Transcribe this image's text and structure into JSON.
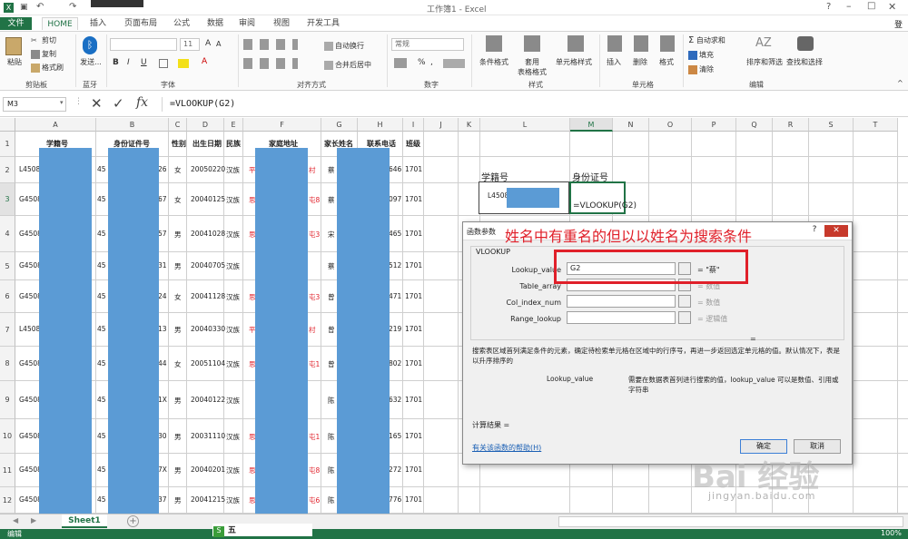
{
  "window": {
    "title": "工作簿1 - Excel",
    "user": "登"
  },
  "tabs": [
    "文件",
    "HOME",
    "插入",
    "页面布局",
    "公式",
    "数据",
    "审阅",
    "视图",
    "开发工具"
  ],
  "ribbon": {
    "clipboard": {
      "paste": "粘贴",
      "cut": "剪切",
      "copy": "复制",
      "format_painter": "格式刷",
      "group": "剪贴板"
    },
    "bluetooth": {
      "send": "发送...",
      "group": "蓝牙"
    },
    "font": {
      "size": "11",
      "bold": "B",
      "italic": "I",
      "underline": "U",
      "group": "字体"
    },
    "alignment": {
      "wrap": "自动换行",
      "merge": "合并后居中",
      "group": "对齐方式"
    },
    "number": {
      "format": "常规",
      "percent": "%",
      "comma": ",",
      "group": "数字"
    },
    "styles": {
      "cond": "条件格式",
      "table": "套用\n表格格式",
      "cell": "单元格样式",
      "group": "样式"
    },
    "cells": {
      "insert": "插入",
      "delete": "删除",
      "format": "格式",
      "group": "单元格"
    },
    "editing": {
      "autosum": "自动求和",
      "fill": "填充",
      "clear": "清除",
      "sort": "排序和筛选",
      "find": "查找和选择",
      "group": "编辑"
    }
  },
  "formula_bar": {
    "name_box": "M3",
    "fx": "fx",
    "formula": "=VLOOKUP(G2)"
  },
  "columns": [
    "A",
    "B",
    "C",
    "D",
    "E",
    "F",
    "G",
    "H",
    "I",
    "J",
    "K",
    "L",
    "M",
    "N",
    "O",
    "P",
    "Q",
    "R",
    "S",
    "T"
  ],
  "rows": [
    "1",
    "2",
    "3",
    "4",
    "5",
    "6",
    "7",
    "8",
    "9",
    "10",
    "11",
    "12"
  ],
  "headers": {
    "A": "学籍号",
    "B": "身份证件号",
    "C": "性别",
    "D": "出生日期",
    "E": "民族",
    "F": "家庭地址",
    "G": "家长姓名",
    "H": "联系电话",
    "I": "班级"
  },
  "table_rows": [
    {
      "a": "L4508",
      "b": "45",
      "b2": "26",
      "c": "女",
      "d": "20050220",
      "e": "汉族",
      "f": "平",
      "f2": "村",
      "g": "蔡",
      "h": "646",
      "i": "1701"
    },
    {
      "a": "G4508",
      "b": "45",
      "b2": "67",
      "c": "女",
      "d": "20040125",
      "e": "汉族",
      "f": "思",
      "f2": "屯8",
      "g": "蔡",
      "h": "097",
      "i": "1701"
    },
    {
      "a": "G4508",
      "b": "45",
      "b2": "57",
      "c": "男",
      "d": "20041028",
      "e": "汉族",
      "f": "思",
      "f2": "屯3",
      "g": "宋",
      "h": "465",
      "i": "1701"
    },
    {
      "a": "G4508",
      "b": "45",
      "b2": "31",
      "c": "男",
      "d": "20040705",
      "e": "汉族",
      "f": "",
      "f2": "",
      "g": "蔡",
      "h": "512",
      "i": "1701"
    },
    {
      "a": "G4508",
      "b": "45",
      "b2": "24",
      "c": "女",
      "d": "20041128",
      "e": "汉族",
      "f": "思",
      "f2": "屯3",
      "g": "曾",
      "h": "471",
      "i": "1701"
    },
    {
      "a": "L4508",
      "b": "45",
      "b2": "13",
      "c": "男",
      "d": "20040330",
      "e": "汉族",
      "f": "平",
      "f2": "村",
      "g": "曾",
      "h": "219",
      "i": "1701"
    },
    {
      "a": "G4508",
      "b": "45",
      "b2": "44",
      "c": "女",
      "d": "20051104",
      "e": "汉族",
      "f": "思",
      "f2": "屯1",
      "g": "曾",
      "h": "802",
      "i": "1701"
    },
    {
      "a": "G4508",
      "b": "45",
      "b2": "1X",
      "c": "男",
      "d": "20040122",
      "e": "汉族",
      "f": "",
      "f2": "",
      "g": "陈",
      "h": "632",
      "i": "1701"
    },
    {
      "a": "G4508",
      "b": "45",
      "b2": "30",
      "c": "男",
      "d": "20031110",
      "e": "汉族",
      "f": "思",
      "f2": "屯1",
      "g": "陈",
      "h": "165",
      "i": "1701"
    },
    {
      "a": "G4508",
      "b": "45",
      "b2": "7X",
      "c": "男",
      "d": "20040201",
      "e": "汉族",
      "f": "思",
      "f2": "屯8",
      "g": "陈",
      "h": "272",
      "i": "1701"
    },
    {
      "a": "G4508",
      "b": "45",
      "b2": "37",
      "c": "男",
      "d": "20041215",
      "e": "汉族",
      "f": "思",
      "f2": "屯6",
      "g": "陈",
      "h": "776",
      "i": "1701"
    }
  ],
  "lookup_box": {
    "h1": "学籍号",
    "h2": "身份证号",
    "l3": "L4508",
    "m3": "=VLOOKUP(G2)"
  },
  "dialog": {
    "title": "函数参数",
    "annotation": "姓名中有重名的但以以姓名为搜索条件",
    "func": "VLOOKUP",
    "args": [
      {
        "name": "Lookup_value",
        "value": "G2",
        "result": "= \"蔡\""
      },
      {
        "name": "Table_array",
        "value": "",
        "result": "= 数值"
      },
      {
        "name": "Col_index_num",
        "value": "",
        "result": "= 数值"
      },
      {
        "name": "Range_lookup",
        "value": "",
        "result": "= 逻辑值"
      }
    ],
    "eq": "=",
    "desc": "搜索表区域首列满足条件的元素，确定待检索单元格在区域中的行序号，再进一步返回选定单元格的值。默认情况下，表是以升序排序的",
    "arg_name": "Lookup_value",
    "arg_desc": "需要在数据表首列进行搜索的值，lookup_value 可以是数值、引用或字符串",
    "calc": "计算结果 =",
    "help": "有关该函数的帮助(H)",
    "ok": "确定",
    "cancel": "取消"
  },
  "sheet": {
    "name": "Sheet1"
  },
  "status": {
    "mode": "编辑",
    "zoom": "100%"
  },
  "watermark": {
    "brand": "Bai 经验",
    "url": "jingyan.baidu.com"
  },
  "ime": "五"
}
